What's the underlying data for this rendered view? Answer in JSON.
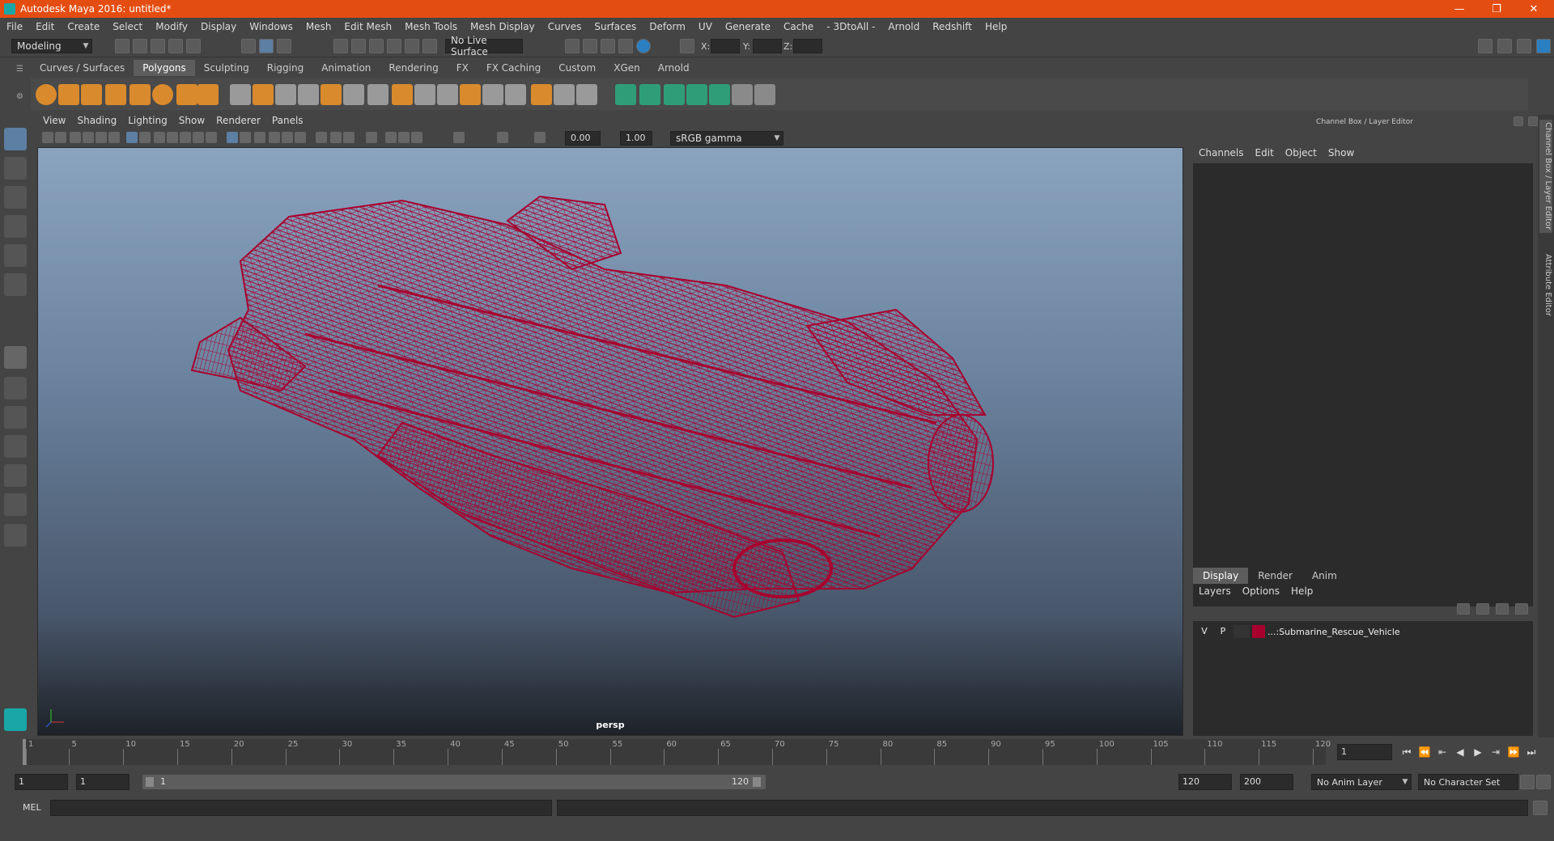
{
  "window": {
    "title": "Autodesk Maya 2016: untitled*",
    "minimize": "—",
    "restore": "❐",
    "close": "✕"
  },
  "menubar": [
    "File",
    "Edit",
    "Create",
    "Select",
    "Modify",
    "Display",
    "Windows",
    "Mesh",
    "Edit Mesh",
    "Mesh Tools",
    "Mesh Display",
    "Curves",
    "Surfaces",
    "Deform",
    "UV",
    "Generate",
    "Cache",
    "- 3DtoAll -",
    "Arnold",
    "Redshift",
    "Help"
  ],
  "statusline": {
    "mode": "Modeling",
    "live_surface": "No Live Surface",
    "x_label": "X:",
    "y_label": "Y:",
    "z_label": "Z:"
  },
  "shelf": {
    "tabs": [
      "Curves / Surfaces",
      "Polygons",
      "Sculpting",
      "Rigging",
      "Animation",
      "Rendering",
      "FX",
      "FX Caching",
      "Custom",
      "XGen",
      "Arnold"
    ],
    "active_tab": "Polygons"
  },
  "panel": {
    "menus": [
      "View",
      "Shading",
      "Lighting",
      "Show",
      "Renderer",
      "Panels"
    ],
    "exposure": "0.00",
    "gamma": "1.00",
    "colorspace": "sRGB gamma",
    "camera": "persp",
    "wire_color": "#a8002e"
  },
  "channelbox": {
    "title": "Channel Box / Layer Editor",
    "menus": [
      "Channels",
      "Edit",
      "Object",
      "Show"
    ]
  },
  "layers": {
    "tabs": [
      "Display",
      "Render",
      "Anim"
    ],
    "active_tab": "Display",
    "menus": [
      "Layers",
      "Options",
      "Help"
    ],
    "row": {
      "visible": "V",
      "playback": "P",
      "name": "...:Submarine_Rescue_Vehicle",
      "color": "#a8002e"
    }
  },
  "sidetabs": [
    "Channel Box / Layer Editor",
    "Attribute Editor"
  ],
  "timeline": {
    "ticks": [
      "1",
      "5",
      "10",
      "15",
      "20",
      "25",
      "30",
      "35",
      "40",
      "45",
      "50",
      "55",
      "60",
      "65",
      "70",
      "75",
      "80",
      "85",
      "90",
      "95",
      "100",
      "105",
      "110",
      "115",
      "120"
    ],
    "current_frame": "1"
  },
  "range": {
    "start": "1",
    "playback_start": "1",
    "slider_start": "1",
    "slider_end": "120",
    "playback_end": "120",
    "end": "200",
    "anim_layer": "No Anim Layer",
    "character_set": "No Character Set"
  },
  "cmdline": {
    "label": "MEL"
  }
}
